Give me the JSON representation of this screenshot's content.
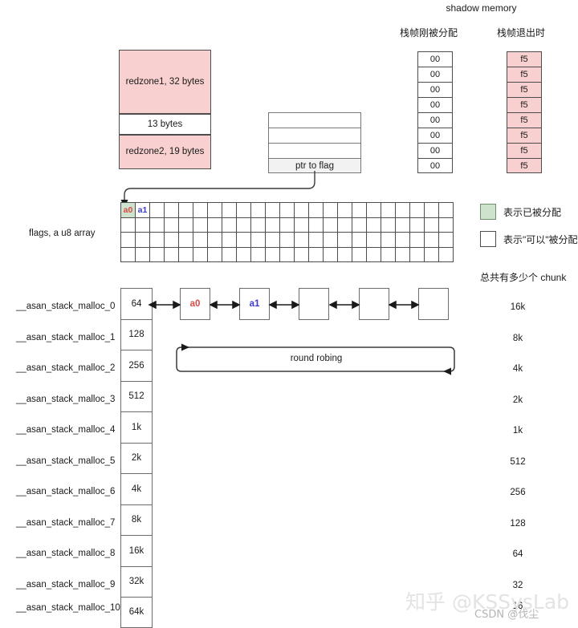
{
  "shadow": {
    "title": "shadow memory",
    "col_left_label": "栈帧刚被分配",
    "col_right_label": "栈帧退出时",
    "left_values": [
      "00",
      "00",
      "00",
      "00",
      "00",
      "00",
      "00",
      "00"
    ],
    "right_values": [
      "f5",
      "f5",
      "f5",
      "f5",
      "f5",
      "f5",
      "f5",
      "f5"
    ],
    "left_fill": "#ffffff",
    "right_fill": "#f8d0d0"
  },
  "frame": {
    "redzone1": "redzone1, 32 bytes",
    "payload": "13 bytes",
    "redzone2": "redzone2, 19 bytes",
    "redzone_color": "#f8d0d0"
  },
  "ptr_stack": {
    "rows": [
      "",
      "",
      "",
      "ptr to flag"
    ],
    "highlight_row_label": "ptr to flag"
  },
  "flags": {
    "label": "flags, a u8 array",
    "rows": 4,
    "cols": 23,
    "cell_a0": "a0",
    "cell_a1": "a1",
    "a0_color": "#d84a45",
    "a1_color": "#3b3bd4",
    "a0_fill": "#cfe2cd"
  },
  "legend": {
    "allocated": "表示已被分配",
    "available": "表示\"可以\"被分配",
    "chunk_count_title": "总共有多少个 chunk",
    "allocated_color": "#cfe2cd",
    "available_color": "#ffffff"
  },
  "malloc_table": {
    "names": [
      "__asan_stack_malloc_0",
      "__asan_stack_malloc_1",
      "__asan_stack_malloc_2",
      "__asan_stack_malloc_3",
      "__asan_stack_malloc_4",
      "__asan_stack_malloc_5",
      "__asan_stack_malloc_6",
      "__asan_stack_malloc_7",
      "__asan_stack_malloc_8",
      "__asan_stack_malloc_9",
      "__asan_stack_malloc_10"
    ],
    "sizes": [
      "64",
      "128",
      "256",
      "512",
      "1k",
      "2k",
      "4k",
      "8k",
      "16k",
      "32k",
      "64k"
    ],
    "chunk_counts": [
      "16k",
      "8k",
      "4k",
      "2k",
      "1k",
      "512",
      "256",
      "128",
      "64",
      "32",
      "16"
    ]
  },
  "chain": {
    "boxes": [
      "a0",
      "a1",
      "",
      "",
      ""
    ],
    "loop_label": "round robing"
  },
  "watermarks": {
    "zhihu": "知乎 @KSSysLab",
    "csdn": "CSDN @伐尘"
  }
}
